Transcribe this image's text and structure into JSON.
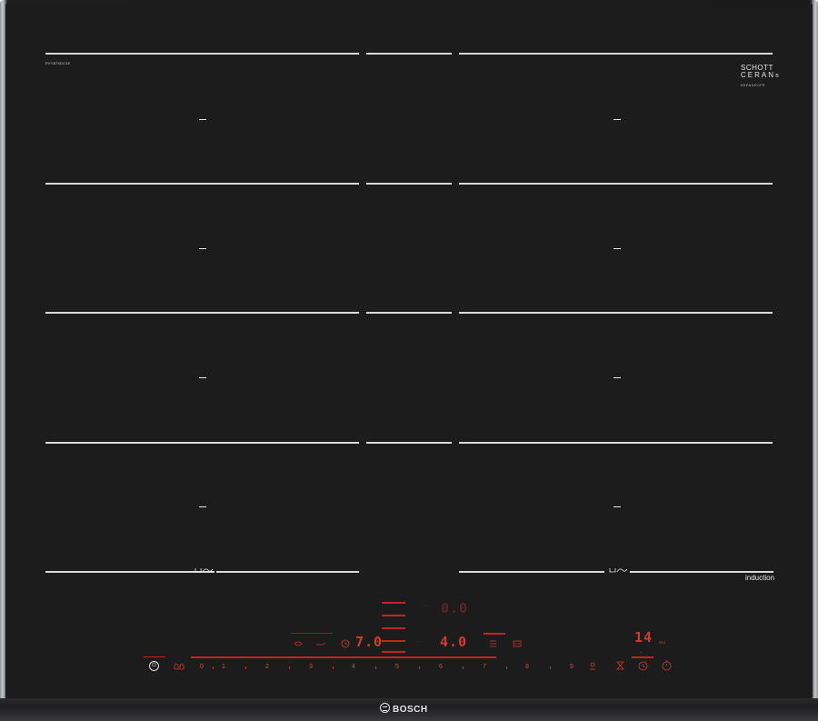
{
  "hob": {
    "model_left": "PXY875DC1E",
    "model_right": "6EE6DE0FE",
    "glass_brand": {
      "line1": "SCHOTT",
      "line2": "CERAN",
      "mark": "®"
    },
    "zones": {
      "off_symbol": "–",
      "flex_icon": "flex-zone-icon"
    },
    "induction_label": "induction"
  },
  "controls": {
    "power": {
      "icon": "power-icon",
      "glyph": "⏻"
    },
    "childlock_icon": "child-lock-icon",
    "displays": {
      "top_center": "0.0",
      "left_level": "7.0",
      "right_level": "4.0",
      "right_timer": "14"
    },
    "timer_unit": "min",
    "slider_numbers": [
      "0",
      "1",
      "2",
      "3",
      "4",
      "5",
      "6",
      "7",
      "8",
      "9"
    ],
    "icons": {
      "move": "move-icon",
      "fry_sensor": "frying-sensor-icon",
      "pan": "pan-icon",
      "timer": "timer-icon",
      "stopwatch": "stopwatch-icon",
      "boost": "boost-icon",
      "menu": "menu-icon",
      "wipe": "wipe-protection-icon"
    }
  },
  "brand": {
    "name": "BOSCH"
  },
  "colors": {
    "glass": "#1c1c1d",
    "display_red": "#d8392b",
    "print_white": "#d9d9d9"
  }
}
